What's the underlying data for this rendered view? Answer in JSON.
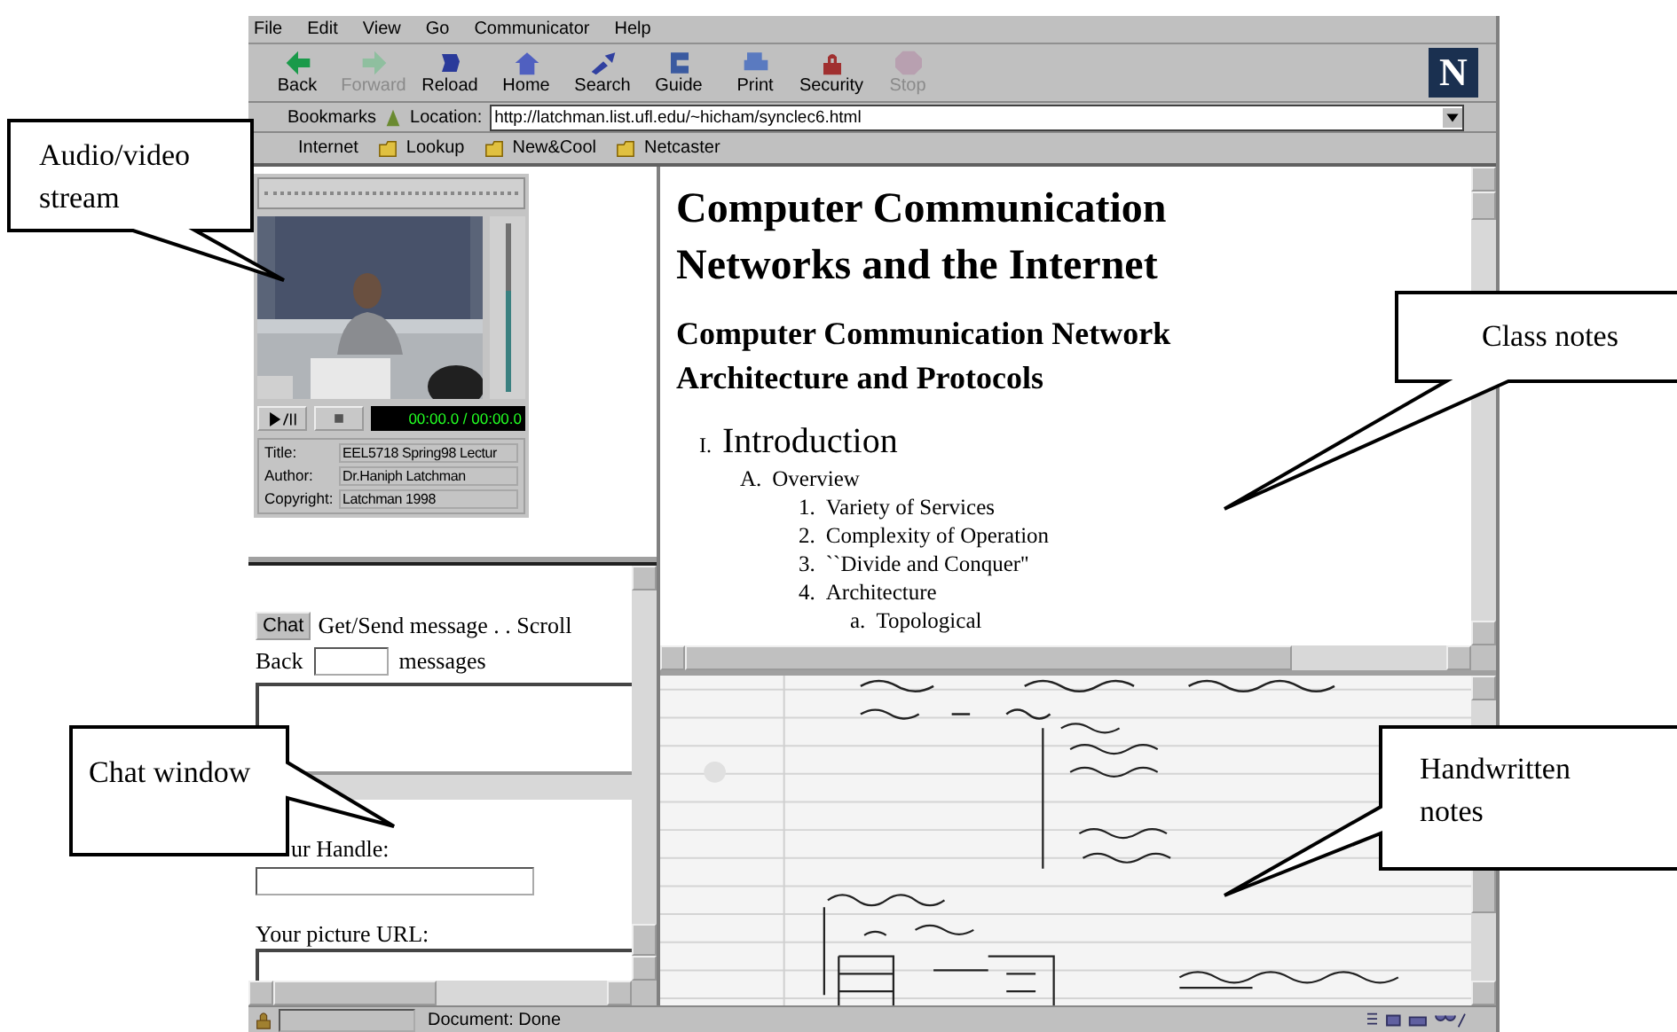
{
  "menu": [
    "File",
    "Edit",
    "View",
    "Go",
    "Communicator",
    "Help"
  ],
  "toolbar": [
    {
      "label": "Back",
      "disabled": false
    },
    {
      "label": "Forward",
      "disabled": true
    },
    {
      "label": "Reload",
      "disabled": false
    },
    {
      "label": "Home",
      "disabled": false
    },
    {
      "label": "Search",
      "disabled": false
    },
    {
      "label": "Guide",
      "disabled": false
    },
    {
      "label": "Print",
      "disabled": false
    },
    {
      "label": "Security",
      "disabled": false
    },
    {
      "label": "Stop",
      "disabled": true
    }
  ],
  "logo": "N",
  "location_bar": {
    "bookmarks": "Bookmarks",
    "label": "Location:",
    "value": "http://latchman.list.ufl.edu/~hicham/synclec6.html"
  },
  "personal_toolbar": [
    "Internet",
    "Lookup",
    "New&Cool",
    "Netcaster"
  ],
  "player": {
    "volume": {
      "level": 0.6
    },
    "time": "00:00.0 / 00:00.0",
    "info": [
      {
        "label": "Title:",
        "value": "EEL5718 Spring98 Lectur"
      },
      {
        "label": "Author:",
        "value": "Dr.Haniph Latchman"
      },
      {
        "label": "Copyright:",
        "value": "Latchman 1998"
      }
    ]
  },
  "chat": {
    "button": "Chat",
    "line": "Get/Send message . . Scroll",
    "back_label": "Back",
    "messages_label": "messages",
    "handle_label": "ur Handle:",
    "picture_url_label": "Your picture URL:"
  },
  "class_notes": {
    "title": "Computer Communication Networks and the Internet",
    "subtitle": "Computer Communication Network Architecture and Protocols",
    "outline": [
      {
        "marker": "I.",
        "text": "Introduction",
        "children": [
          {
            "marker": "A.",
            "text": "Overview",
            "children": [
              {
                "marker": "1.",
                "text": "Variety of Services"
              },
              {
                "marker": "2.",
                "text": "Complexity of Operation"
              },
              {
                "marker": "3.",
                "text": "``Divide and Conquer''"
              },
              {
                "marker": "4.",
                "text": "Architecture",
                "children": [
                  {
                    "marker": "a.",
                    "text": "Topological"
                  }
                ]
              }
            ]
          }
        ]
      }
    ]
  },
  "status_bar": {
    "text": "Document: Done"
  },
  "callouts": [
    {
      "text": "Audio/video stream"
    },
    {
      "text": "Class notes"
    },
    {
      "text": "Chat window"
    },
    {
      "text": "Handwritten notes"
    }
  ]
}
